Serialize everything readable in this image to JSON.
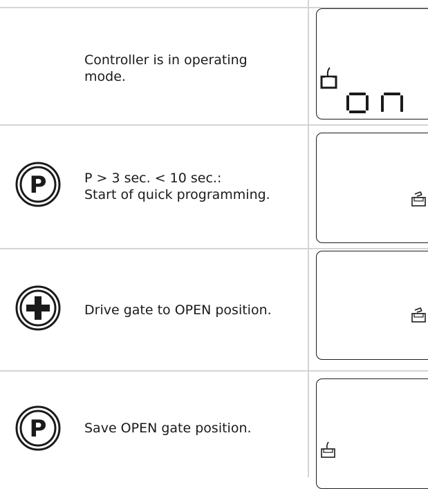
{
  "rows": [
    {
      "button": null,
      "text_lines": [
        "Controller is in operating",
        "mode."
      ],
      "display": {
        "icon": "gate-closed-icon",
        "segments": "on"
      }
    },
    {
      "button": "program-button-icon",
      "text_lines": [
        "P > 3 sec. < 10 sec.:",
        "Start of quick programming."
      ],
      "display": {
        "icon": "gate-open-icon",
        "segments": ""
      }
    },
    {
      "button": "plus-button-icon",
      "text_lines": [
        "Drive gate to OPEN position."
      ],
      "display": {
        "icon": "gate-open-icon",
        "segments": ""
      }
    },
    {
      "button": "program-button-icon",
      "text_lines": [
        "Save OPEN gate position."
      ],
      "display": {
        "icon": "gate-closed-icon",
        "segments": ""
      }
    }
  ]
}
